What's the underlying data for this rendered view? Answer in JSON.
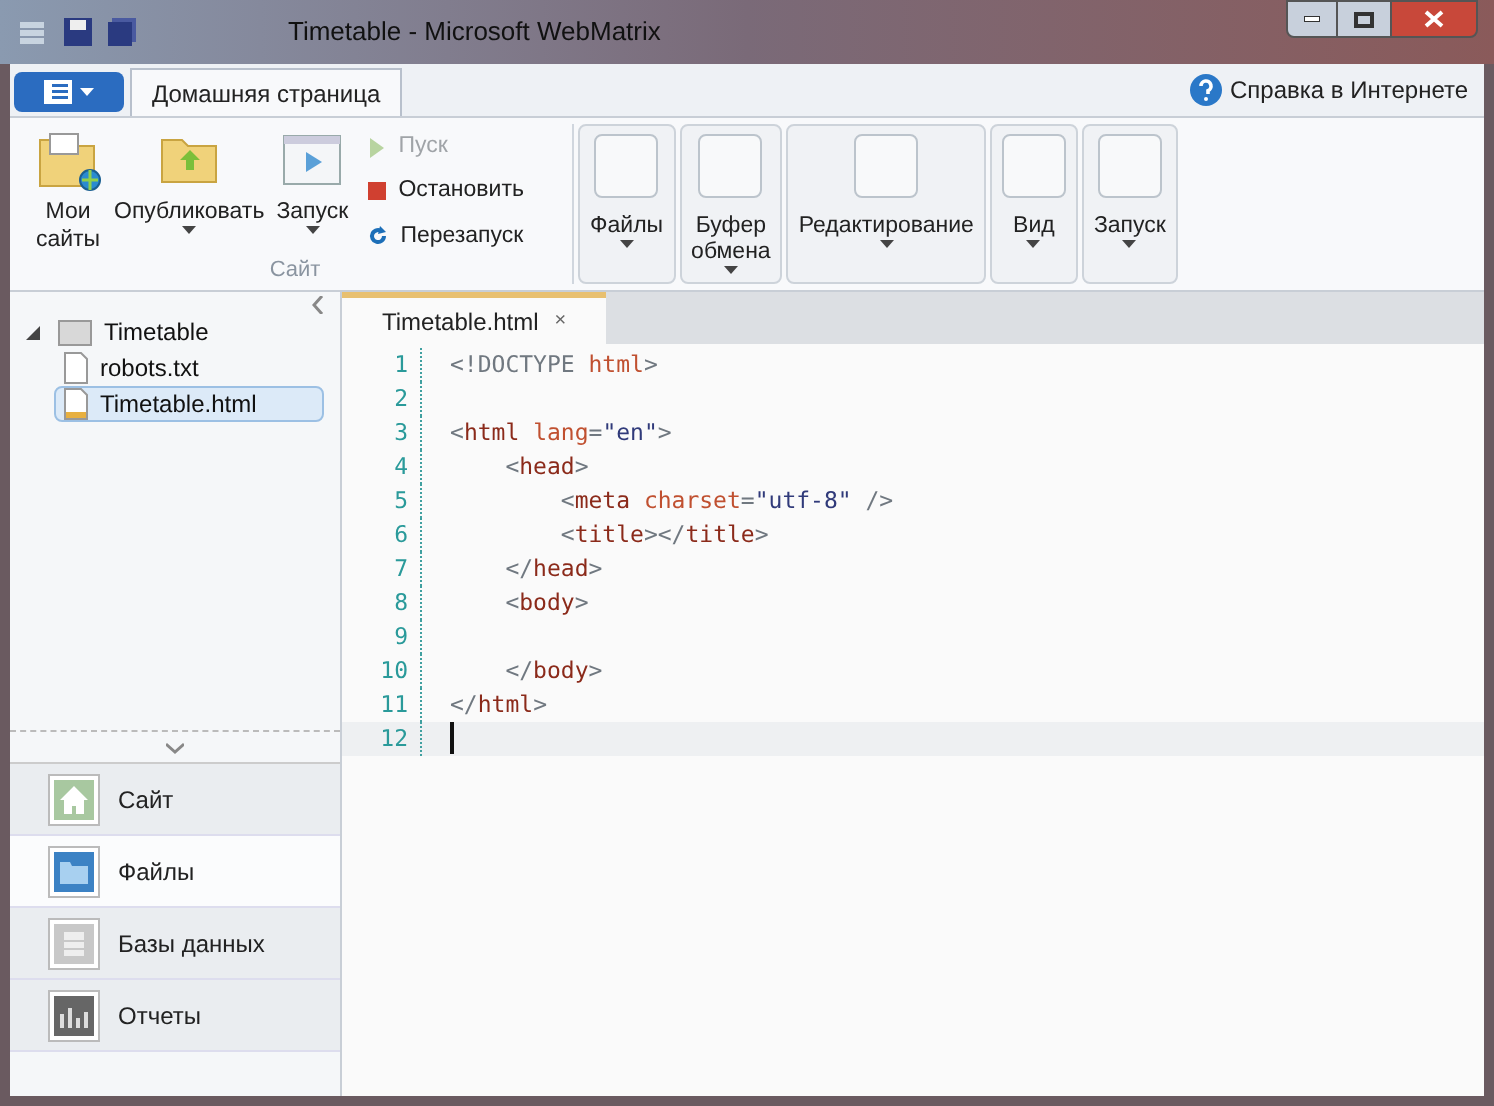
{
  "window": {
    "title": "Timetable - Microsoft WebMatrix"
  },
  "ribbon": {
    "tabs": [
      {
        "label": "Домашняя страница",
        "selected": true
      }
    ],
    "help": "Справка в Интернете",
    "site_group": {
      "label": "Сайт",
      "big_buttons": [
        {
          "label": "Мои сайты",
          "kind": "sites",
          "dropdown": false
        },
        {
          "label": "Опубликовать",
          "kind": "publish",
          "dropdown": true
        },
        {
          "label": "Запуск",
          "kind": "run",
          "dropdown": true
        }
      ],
      "small_buttons": [
        {
          "label": "Пуск",
          "kind": "play",
          "disabled": true
        },
        {
          "label": "Остановить",
          "kind": "stop",
          "disabled": false
        },
        {
          "label": "Перезапуск",
          "kind": "restart",
          "disabled": false
        }
      ]
    },
    "groups": [
      {
        "label": "Файлы"
      },
      {
        "label": "Буфер обмена"
      },
      {
        "label": "Редактирование"
      },
      {
        "label": "Вид"
      },
      {
        "label": "Запуск"
      }
    ]
  },
  "tree": [
    {
      "label": "Timetable",
      "kind": "folder",
      "expanded": true,
      "selected": false,
      "children": [
        {
          "label": "robots.txt",
          "kind": "file",
          "selected": false
        },
        {
          "label": "Timetable.html",
          "kind": "html",
          "selected": true
        }
      ]
    }
  ],
  "nav": [
    {
      "label": "Сайт",
      "kind": "site",
      "selected": false
    },
    {
      "label": "Файлы",
      "kind": "files",
      "selected": true
    },
    {
      "label": "Базы данных",
      "kind": "db",
      "selected": false
    },
    {
      "label": "Отчеты",
      "kind": "reports",
      "selected": false
    }
  ],
  "editor": {
    "tabs": [
      {
        "label": "Timetable.html",
        "selected": true,
        "close": "×"
      }
    ],
    "lines": [
      {
        "n": "1",
        "current": false,
        "tokens": [
          {
            "kind": "p",
            "t": "<!DOCTYPE "
          },
          {
            "kind": "a",
            "t": "html"
          },
          {
            "kind": "p",
            "t": ">"
          }
        ]
      },
      {
        "n": "2",
        "current": false
      },
      {
        "n": "3",
        "current": false,
        "tokens": [
          {
            "kind": "p",
            "t": "<"
          },
          {
            "kind": "tag",
            "t": "html"
          },
          {
            "kind": "a",
            "t": " lang"
          },
          {
            "kind": "p",
            "t": "="
          },
          {
            "kind": "v",
            "t": "\"en\""
          },
          {
            "kind": "p",
            "t": ">"
          }
        ]
      },
      {
        "n": "4",
        "current": false,
        "tokens": [
          {
            "kind": "p",
            "t": "    <"
          },
          {
            "kind": "tag",
            "t": "head"
          },
          {
            "kind": "p",
            "t": ">"
          }
        ]
      },
      {
        "n": "5",
        "current": false,
        "tokens": [
          {
            "kind": "p",
            "t": "        <"
          },
          {
            "kind": "tag",
            "t": "meta"
          },
          {
            "kind": "a",
            "t": " charset"
          },
          {
            "kind": "p",
            "t": "="
          },
          {
            "kind": "v",
            "t": "\"utf-8\""
          },
          {
            "kind": "p",
            "t": " />"
          }
        ]
      },
      {
        "n": "6",
        "current": false,
        "tokens": [
          {
            "kind": "p",
            "t": "        <"
          },
          {
            "kind": "tag",
            "t": "title"
          },
          {
            "kind": "p",
            "t": "></"
          },
          {
            "kind": "tag",
            "t": "title"
          },
          {
            "kind": "p",
            "t": ">"
          }
        ]
      },
      {
        "n": "7",
        "current": false,
        "tokens": [
          {
            "kind": "p",
            "t": "    </"
          },
          {
            "kind": "tag",
            "t": "head"
          },
          {
            "kind": "p",
            "t": ">"
          }
        ]
      },
      {
        "n": "8",
        "current": false,
        "tokens": [
          {
            "kind": "p",
            "t": "    <"
          },
          {
            "kind": "tag",
            "t": "body"
          },
          {
            "kind": "p",
            "t": ">"
          }
        ]
      },
      {
        "n": "9",
        "current": false
      },
      {
        "n": "10",
        "current": false,
        "tokens": [
          {
            "kind": "p",
            "t": "    </"
          },
          {
            "kind": "tag",
            "t": "body"
          },
          {
            "kind": "p",
            "t": ">"
          }
        ]
      },
      {
        "n": "11",
        "current": false,
        "tokens": [
          {
            "kind": "p",
            "t": "</"
          },
          {
            "kind": "tag",
            "t": "html"
          },
          {
            "kind": "p",
            "t": ">"
          }
        ]
      },
      {
        "n": "12",
        "current": true
      }
    ]
  }
}
